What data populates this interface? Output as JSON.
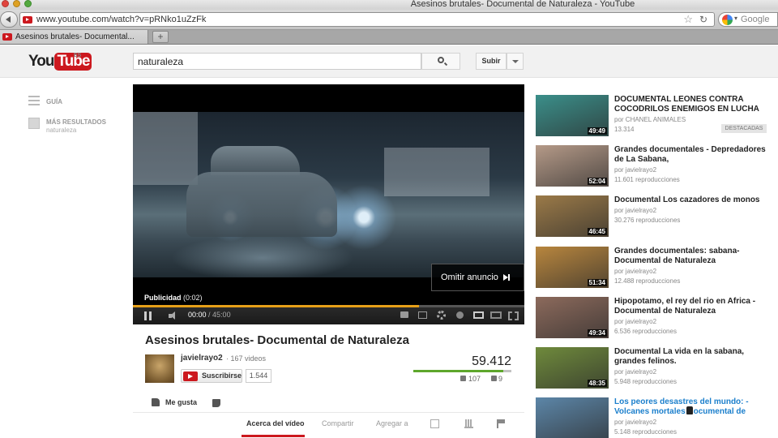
{
  "browser": {
    "window_title": "Asesinos brutales- Documental de Naturaleza - YouTube",
    "url": "www.youtube.com/watch?v=pRNko1uZzFk",
    "search_engine": "Google",
    "tab_label": "Asesinos brutales- Documental...",
    "new_tab_label": "+"
  },
  "masthead": {
    "logo_you": "You",
    "logo_tube": "Tube",
    "region": "ES",
    "search_value": "naturaleza",
    "upload_label": "Subir"
  },
  "guide": {
    "guide_label": "GUÍA",
    "more_results_label": "MÁS RESULTADOS",
    "more_results_query": "naturaleza"
  },
  "player": {
    "skip_ad_label": "Omitir anuncio",
    "ad_label": "Publicidad",
    "ad_time": "(0:02)",
    "time_current": "00:00",
    "time_total": "/ 45:00",
    "progress_fraction": 0.73
  },
  "video": {
    "title": "Asesinos brutales- Documental de Naturaleza",
    "channel": "javielrayo2",
    "channel_videos": "· 167 videos",
    "subscribe_label": "Suscribirse",
    "subscriber_count": "1.544",
    "views": "59.412",
    "likes": "107",
    "dislikes": "9",
    "like_ratio": 0.92,
    "like_label": "Me gusta",
    "tabs": [
      "Acerca del vídeo",
      "Compartir",
      "Agregar a"
    ]
  },
  "related": [
    {
      "title": "DOCUMENTAL LEONES CONTRA COCODRILOS ENEMIGOS EN LUCHA",
      "by": "por CHANEL ANIMALES",
      "views": "13.314",
      "duration": "49:49",
      "badge": "DESTACADAS",
      "thumb_color": "#3b8f8a"
    },
    {
      "title": "Grandes documentales - Depredadores de La Sabana,",
      "by": "por javielrayo2",
      "views": "11.601 reproducciones",
      "duration": "52:04",
      "thumb_color": "#b59a88"
    },
    {
      "title": "Documental Los cazadores de monos",
      "by": "por javielrayo2",
      "views": "30.276 reproducciones",
      "duration": "46:45",
      "thumb_color": "#9b7a48"
    },
    {
      "title": "Grandes documentales: sabana- Documental de Naturaleza",
      "by": "por javielrayo2",
      "views": "12.488 reproducciones",
      "duration": "51:34",
      "thumb_color": "#b8863e"
    },
    {
      "title": "Hipopotamo, el rey del rio en Africa -Documental de Naturaleza",
      "by": "por javielrayo2",
      "views": "6.536 reproducciones",
      "duration": "49:34",
      "thumb_color": "#8c6a5c"
    },
    {
      "title": "Documental La vida en la sabana, grandes felinos.",
      "by": "por javielrayo2",
      "views": "5.948 reproducciones",
      "duration": "48:35",
      "thumb_color": "#6f8a3c"
    },
    {
      "title": "Los peores desastres del mundo: - Volcanes mortales Documental de",
      "by": "por javielrayo2",
      "views": "5.148 reproducciones",
      "duration": "",
      "thumb_color": "#5c86a8",
      "highlighted": true
    }
  ]
}
